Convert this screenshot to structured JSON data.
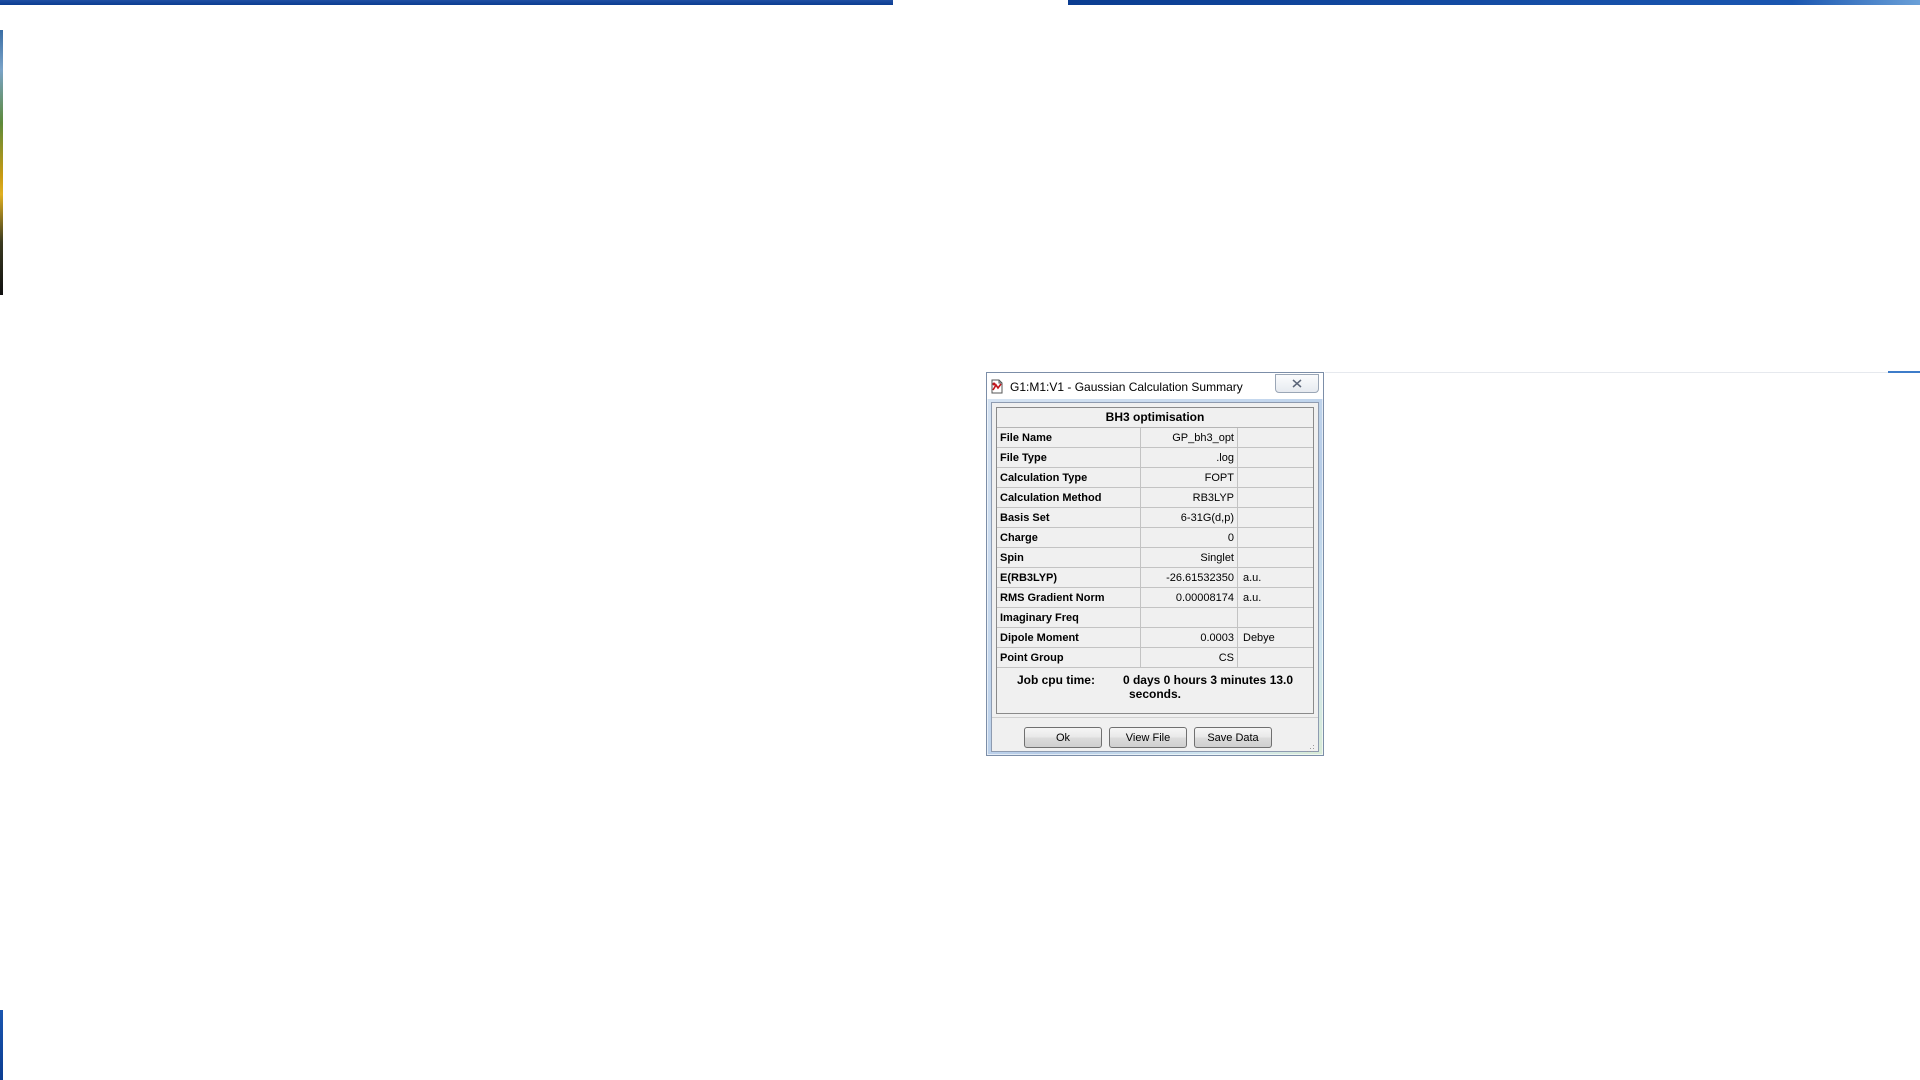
{
  "dialog": {
    "title": "G1:M1:V1 - Gaussian Calculation Summary",
    "summary_title": "BH3 optimisation",
    "rows": [
      {
        "label": "File Name",
        "value": "GP_bh3_opt",
        "unit": ""
      },
      {
        "label": "File Type",
        "value": ".log",
        "unit": ""
      },
      {
        "label": "Calculation Type",
        "value": "FOPT",
        "unit": ""
      },
      {
        "label": "Calculation Method",
        "value": "RB3LYP",
        "unit": ""
      },
      {
        "label": "Basis Set",
        "value": "6-31G(d,p)",
        "unit": ""
      },
      {
        "label": "Charge",
        "value": "0",
        "unit": ""
      },
      {
        "label": "Spin",
        "value": "Singlet",
        "unit": ""
      },
      {
        "label": "E(RB3LYP)",
        "value": "-26.61532350",
        "unit": "a.u."
      },
      {
        "label": "RMS Gradient Norm",
        "value": "0.00008174",
        "unit": "a.u."
      },
      {
        "label": "Imaginary Freq",
        "value": "",
        "unit": ""
      },
      {
        "label": "Dipole Moment",
        "value": "0.0003",
        "unit": "Debye"
      },
      {
        "label": "Point Group",
        "value": "CS",
        "unit": ""
      }
    ],
    "cpu_label": "Job cpu time:",
    "cpu_value": "0 days  0 hours  3 minutes 13.0 seconds.",
    "buttons": {
      "ok": "Ok",
      "view_file": "View File",
      "save_data": "Save Data"
    }
  },
  "icons": {
    "title": "document-icon",
    "close": "close-icon",
    "grip": "resize-grip-icon"
  }
}
